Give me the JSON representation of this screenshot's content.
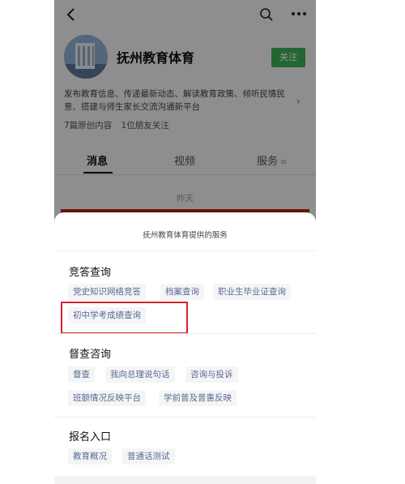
{
  "profile": {
    "account_name": "抚州教育体育",
    "follow_label": "关注",
    "description": "发布教育信息、传递最新动态、解读教育政策、倾听民情民意、搭建与师生家长交流沟通新平台",
    "original_count": "7篇原创内容",
    "friends_following": "1位朋友关注"
  },
  "tabs": [
    {
      "label": "消息"
    },
    {
      "label": "视频"
    },
    {
      "label": "服务"
    }
  ],
  "feed": {
    "date_label": "昨天"
  },
  "sheet": {
    "title": "抚州教育体育提供的服务",
    "sections": [
      {
        "heading": "竞答查询",
        "items": [
          "党史知识网络竞答",
          "档案查询",
          "职业生毕业证查询",
          "初中学考成绩查询"
        ]
      },
      {
        "heading": "督查咨询",
        "items": [
          "督查",
          "我向总理说句话",
          "咨询与投诉",
          "班额情况反映平台",
          "学前普及普惠反映"
        ]
      },
      {
        "heading": "报名入口",
        "items": [
          "教育概况",
          "普通话测试"
        ]
      }
    ]
  },
  "colors": {
    "follow_green": "#3fae5a",
    "link_blue": "#576b95",
    "highlight_red": "#d8232a"
  },
  "icons": {
    "back": "back-arrow-icon",
    "search": "search-icon",
    "more": "more-icon",
    "tab_menu": "menu-icon"
  }
}
